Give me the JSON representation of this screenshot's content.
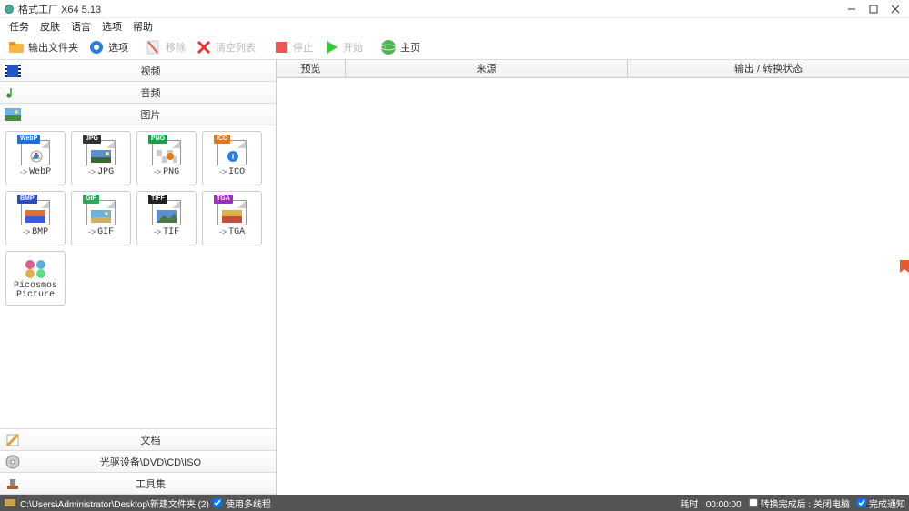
{
  "window": {
    "title": "格式工厂 X64 5.13"
  },
  "menu": {
    "task": "任务",
    "skin": "皮肤",
    "language": "语言",
    "options": "选项",
    "help": "帮助"
  },
  "toolbar": {
    "output_folder": "输出文件夹",
    "options": "选项",
    "remove": "移除",
    "clear": "清空列表",
    "stop": "停止",
    "start": "开始",
    "home": "主页"
  },
  "categories": {
    "video": "视频",
    "audio": "音频",
    "image": "图片",
    "document": "文档",
    "disc": "光驱设备\\DVD\\CD\\ISO",
    "tools": "工具集"
  },
  "formats": [
    {
      "label": "WebP",
      "badge": "WebP",
      "color": "#1d6fd6",
      "arrow": true
    },
    {
      "label": "JPG",
      "badge": "JPG",
      "color": "#333333",
      "arrow": true
    },
    {
      "label": "PNG",
      "badge": "PNG",
      "color": "#18a048",
      "arrow": true
    },
    {
      "label": "ICO",
      "badge": "ICO",
      "color": "#e07a1f",
      "arrow": true
    },
    {
      "label": "BMP",
      "badge": "BMP",
      "color": "#2a4cc0",
      "arrow": true
    },
    {
      "label": "GIF",
      "badge": "GIF",
      "color": "#2fa85a",
      "arrow": true
    },
    {
      "label": "TIF",
      "badge": "TIFF",
      "color": "#222222",
      "arrow": true
    },
    {
      "label": "TGA",
      "badge": "TGA",
      "color": "#9b2fbf",
      "arrow": true
    },
    {
      "label": "Picosmos Picture",
      "badge": "",
      "color": "",
      "arrow": false
    }
  ],
  "columns": {
    "preview": "预览",
    "source": "来源",
    "output_status": "输出 / 转换状态"
  },
  "status": {
    "path": "C:\\Users\\Administrator\\Desktop\\新建文件夹 (2)",
    "multithread": "使用多线程",
    "elapsed": "耗时 : 00:00:00",
    "shutdown": "转换完成后 : 关闭电脑",
    "notify": "完成通知"
  }
}
